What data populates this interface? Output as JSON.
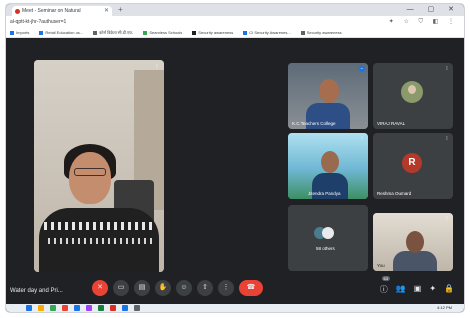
{
  "browser": {
    "tab_title": "Meet - Seminar on Natural",
    "new_tab": "+",
    "window_controls": "— ▢ ✕",
    "address": "al-qptt-kt-jhr-?authuser=1",
    "address_icons": "✦ ☆ ⛉ ◧ ⋮",
    "bookmarks": [
      {
        "label": "Imports",
        "color": "#1a73e8"
      },
      {
        "label": "Retail Education us...",
        "color": "#1a73e8"
      },
      {
        "label": "कोर्स विक्रेता सी.डी.एफ.",
        "color": "#5f6368"
      },
      {
        "label": "Seamless Schools",
        "color": "#34a853"
      },
      {
        "label": "Security awareness",
        "color": "#202124"
      },
      {
        "label": "CI Security Awarenes...",
        "color": "#1a73e8"
      },
      {
        "label": "Security awareness",
        "color": "#5f6368"
      }
    ]
  },
  "meet": {
    "main_tile": {
      "mic_icon": "⁞"
    },
    "tiles": [
      {
        "name": "K.C.Teachers College",
        "mic_icon": "−"
      },
      {
        "name": "VIRAJ RAVAL",
        "mic_icon": "⁞"
      },
      {
        "name": "Jitendra Pandya",
        "mic_icon": "⁞"
      },
      {
        "name": "Reshma Oumard",
        "initial": "R",
        "mic_icon": "⁞"
      },
      {
        "name": "58 others"
      },
      {
        "name": "You",
        "mic_icon": "⁞"
      }
    ],
    "meeting_title": "Water day and Pri...",
    "controls": [
      {
        "name": "mic-off",
        "glyph": "✕"
      },
      {
        "name": "camera",
        "glyph": "▭"
      },
      {
        "name": "captions",
        "glyph": "▤"
      },
      {
        "name": "raise-hand",
        "glyph": "✋"
      },
      {
        "name": "emoji",
        "glyph": "☺"
      },
      {
        "name": "present",
        "glyph": "⇧"
      },
      {
        "name": "more",
        "glyph": "⋮"
      },
      {
        "name": "end-call",
        "glyph": "☎"
      }
    ],
    "right_controls": [
      {
        "name": "info",
        "glyph": "ⓘ"
      },
      {
        "name": "people",
        "glyph": "👥"
      },
      {
        "name": "chat",
        "glyph": "▣"
      },
      {
        "name": "activities",
        "glyph": "✦"
      },
      {
        "name": "host-controls",
        "glyph": "🔒"
      }
    ],
    "people_count": "63"
  },
  "taskbar": {
    "clock": "4:12 PM",
    "icon_colors": [
      "#1a73e8",
      "#f9ab00",
      "#34a853",
      "#ea4335",
      "#1a73e8",
      "#a142f4",
      "#188038",
      "#d93025",
      "#1a73e8",
      "#5f6368"
    ]
  }
}
